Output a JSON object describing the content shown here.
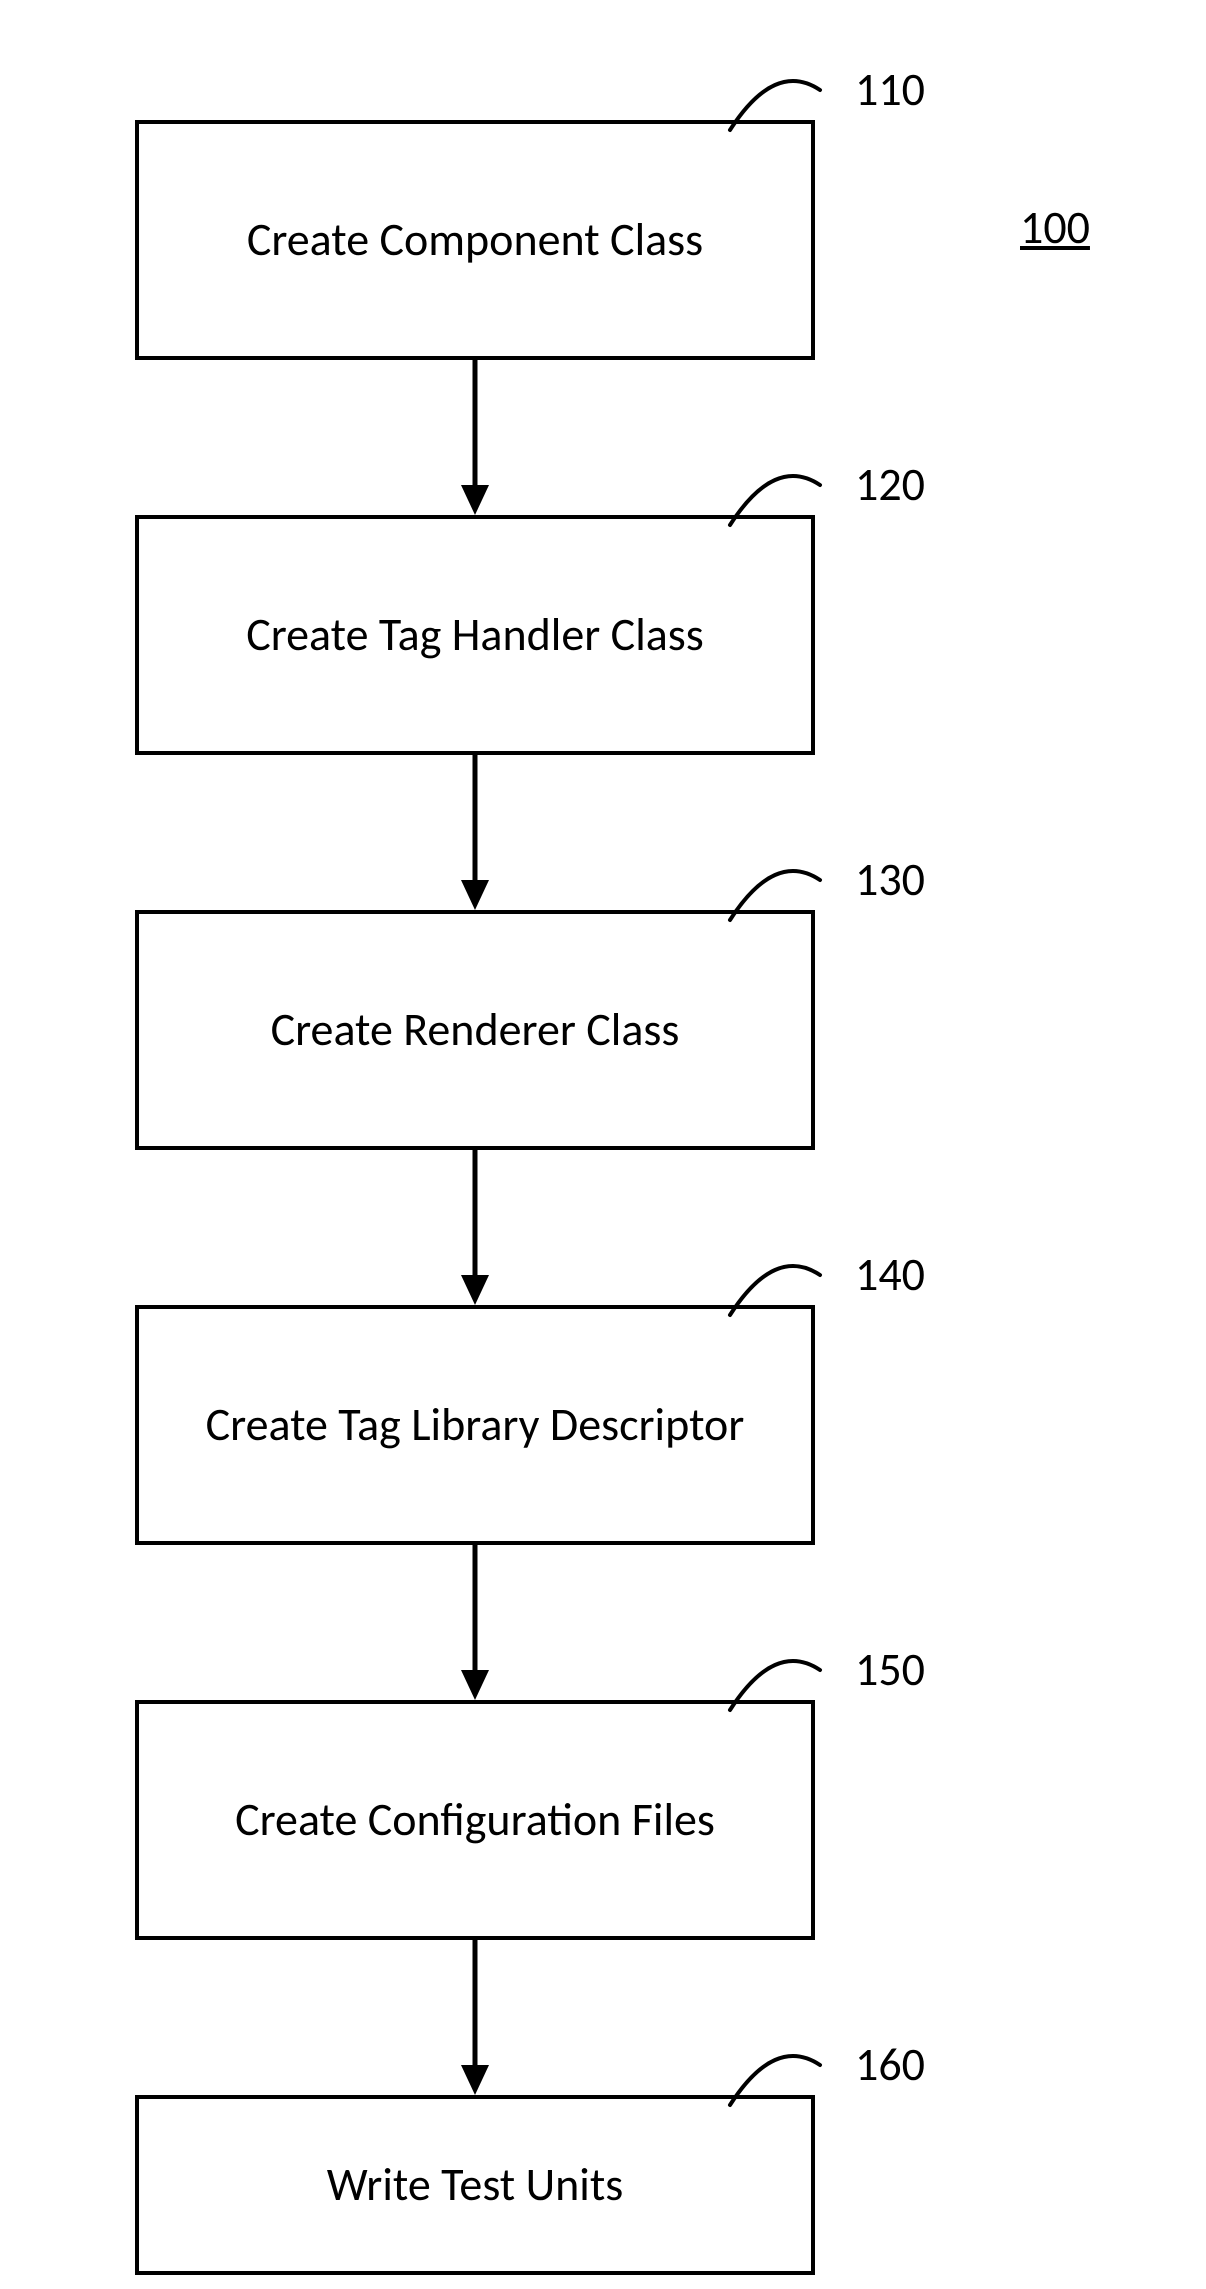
{
  "figure": {
    "label": "100"
  },
  "steps": [
    {
      "ref": "110",
      "text": "Create Component Class"
    },
    {
      "ref": "120",
      "text": "Create Tag Handler Class"
    },
    {
      "ref": "130",
      "text": "Create Renderer Class"
    },
    {
      "ref": "140",
      "text": "Create Tag Library Descriptor"
    },
    {
      "ref": "150",
      "text": "Create Configuration Files"
    },
    {
      "ref": "160",
      "text": "Write Test Units"
    }
  ],
  "chart_data": {
    "type": "flowchart",
    "title": "100",
    "nodes": [
      {
        "id": "110",
        "label": "Create Component Class"
      },
      {
        "id": "120",
        "label": "Create Tag Handler Class"
      },
      {
        "id": "130",
        "label": "Create Renderer Class"
      },
      {
        "id": "140",
        "label": "Create Tag Library Descriptor"
      },
      {
        "id": "150",
        "label": "Create Configuration Files"
      },
      {
        "id": "160",
        "label": "Write Test Units"
      }
    ],
    "edges": [
      {
        "from": "110",
        "to": "120"
      },
      {
        "from": "120",
        "to": "130"
      },
      {
        "from": "130",
        "to": "140"
      },
      {
        "from": "140",
        "to": "150"
      },
      {
        "from": "150",
        "to": "160"
      }
    ]
  }
}
